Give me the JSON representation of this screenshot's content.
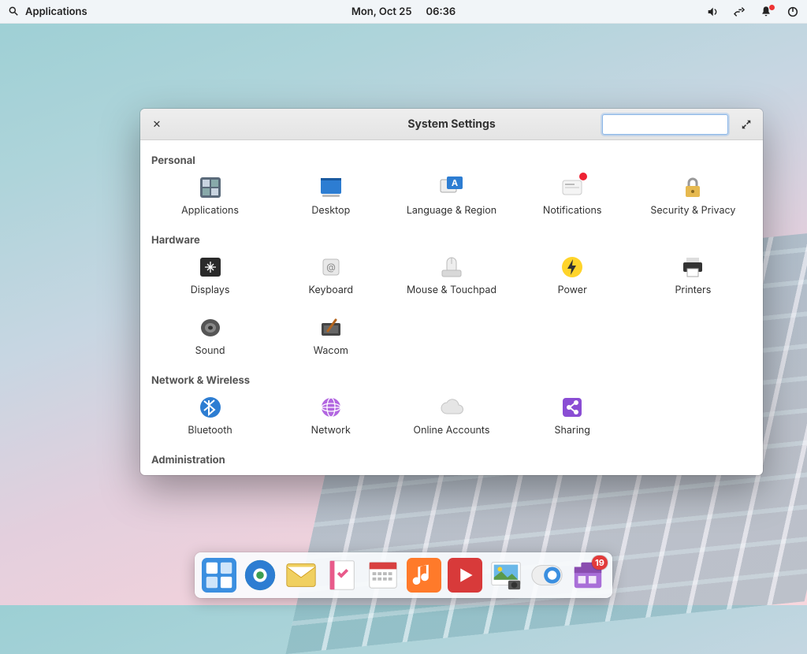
{
  "topbar": {
    "apps_label": "Applications",
    "date": "Mon, Oct 25",
    "time": "06:36"
  },
  "window": {
    "title": "System Settings",
    "search_placeholder": ""
  },
  "sections": {
    "personal": {
      "label": "Personal",
      "items": [
        "Applications",
        "Desktop",
        "Language & Region",
        "Notifications",
        "Security & Privacy"
      ]
    },
    "hardware": {
      "label": "Hardware",
      "items": [
        "Displays",
        "Keyboard",
        "Mouse & Touchpad",
        "Power",
        "Printers",
        "Sound",
        "Wacom"
      ]
    },
    "network": {
      "label": "Network & Wireless",
      "items": [
        "Bluetooth",
        "Network",
        "Online Accounts",
        "Sharing"
      ]
    },
    "admin": {
      "label": "Administration"
    }
  },
  "dock": {
    "badge": "19",
    "items": [
      "multitasking",
      "web-browser",
      "mail",
      "tasks",
      "calendar",
      "music",
      "videos",
      "photos",
      "settings",
      "app-center"
    ]
  },
  "icons": {
    "volume": "volume-icon",
    "network": "network-icon",
    "notify": "notify-icon",
    "power": "power-icon"
  }
}
